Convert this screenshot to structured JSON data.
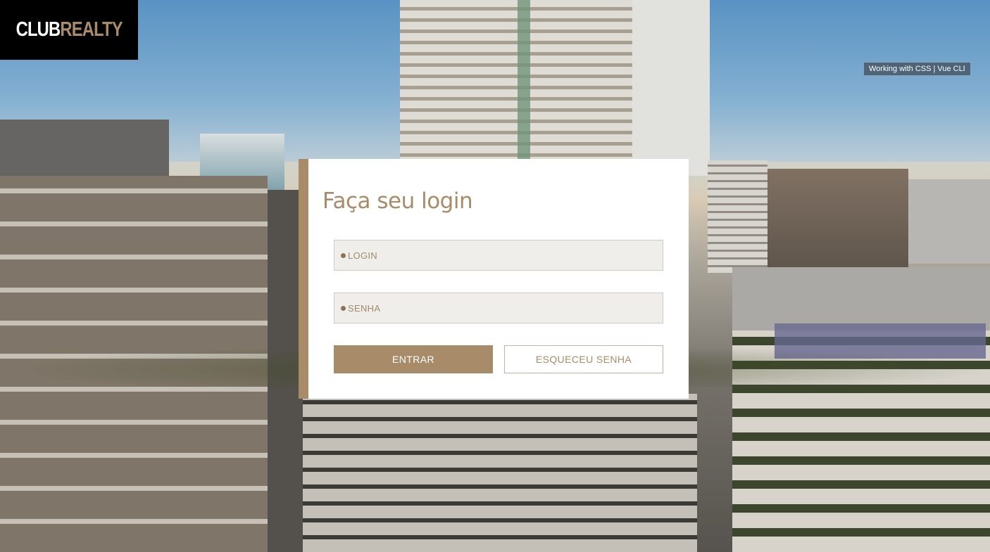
{
  "brand": {
    "name_part1": "CLUB",
    "name_part2": "REALTY",
    "colors": {
      "accent": "#a88b68",
      "logo_bg": "#000000"
    }
  },
  "dev_badge": {
    "text": "Working with CSS | Vue CLI"
  },
  "login_form": {
    "title": "Faça seu login",
    "login_placeholder": "LOGIN",
    "password_placeholder": "SENHA",
    "submit_label": "ENTRAR",
    "forgot_label": "ESQUECEU SENHA"
  },
  "background": {
    "icon": "city-skyline-photo"
  }
}
